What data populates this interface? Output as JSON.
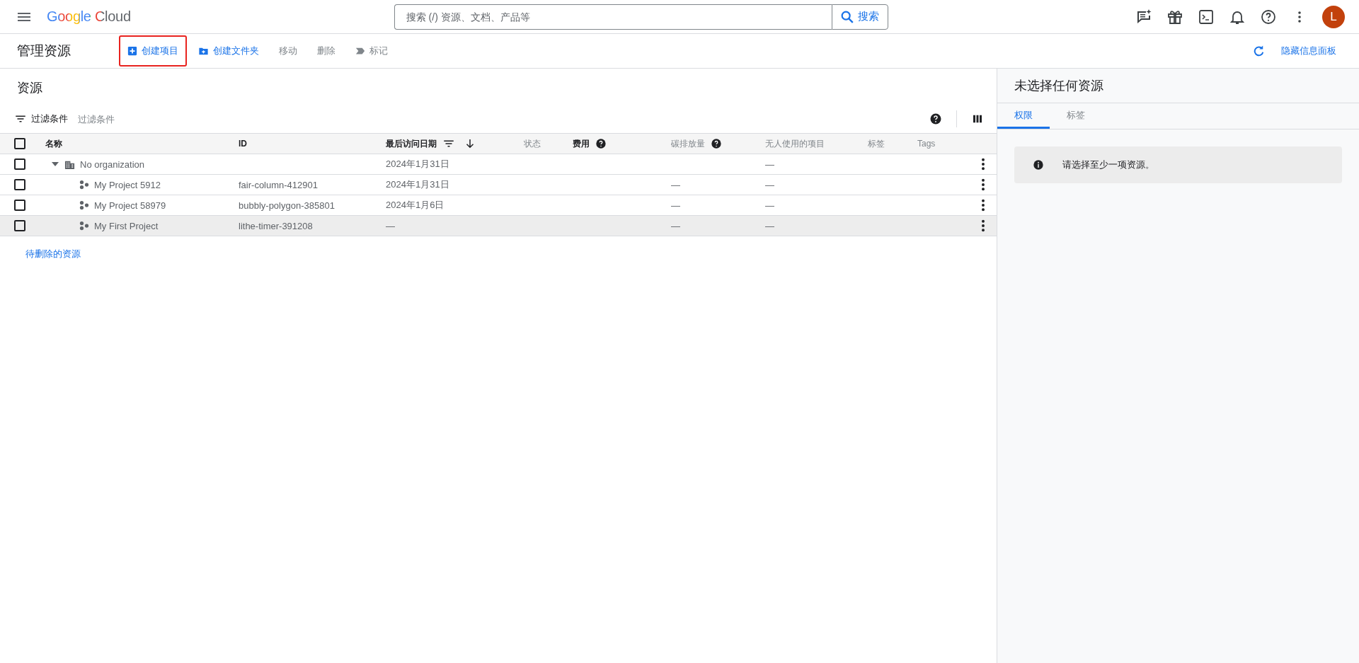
{
  "header": {
    "brand": "Google Cloud",
    "search": {
      "placeholder": "搜索 (/) 资源、文档、产品等",
      "button": "搜索"
    },
    "avatar": "L"
  },
  "toolbar": {
    "title": "管理资源",
    "actions": [
      {
        "label": "创建项目",
        "disabled": false,
        "highlighted": true
      },
      {
        "label": "创建文件夹",
        "disabled": false,
        "highlighted": false
      },
      {
        "label": "移动",
        "disabled": true,
        "highlighted": false
      },
      {
        "label": "删除",
        "disabled": true,
        "highlighted": false
      },
      {
        "label": "标记",
        "disabled": true,
        "highlighted": false
      }
    ],
    "hide_panel": "隐藏信息面板"
  },
  "resources": {
    "title": "资源",
    "select_all_checked": false,
    "filter": {
      "label": "过滤条件",
      "placeholder": "过滤条件"
    },
    "columns": [
      {
        "label": "名称",
        "dark": true,
        "help": false,
        "sort": false
      },
      {
        "label": "ID",
        "dark": true,
        "help": false,
        "sort": false
      },
      {
        "label": "最后访问日期",
        "dark": true,
        "help": false,
        "sort": true
      },
      {
        "label": "状态",
        "dark": false,
        "help": false,
        "sort": false
      },
      {
        "label": "费用",
        "dark": true,
        "help": true,
        "sort": false
      },
      {
        "label": "碳排放量",
        "dark": false,
        "help": true,
        "sort": false
      },
      {
        "label": "无人使用的项目",
        "dark": false,
        "help": false,
        "sort": false
      },
      {
        "label": "标签",
        "dark": false,
        "help": false,
        "sort": false
      },
      {
        "label": "Tags",
        "dark": false,
        "help": false,
        "sort": false
      }
    ],
    "rows": [
      {
        "kind": "organization",
        "name": "No organization",
        "id": "",
        "date": "2024年1月31日",
        "carbon": "",
        "unused": "—",
        "checked": false,
        "expanded": true,
        "children": [
          {
            "kind": "project",
            "name": "My Project 5912",
            "id": "fair-column-412901",
            "date": "2024年1月31日",
            "carbon": "—",
            "unused": "—",
            "checked": false,
            "hovered": false
          },
          {
            "kind": "project",
            "name": "My Project 58979",
            "id": "bubbly-polygon-385801",
            "date": "2024年1月6日",
            "carbon": "—",
            "unused": "—",
            "checked": false,
            "hovered": false
          },
          {
            "kind": "project",
            "name": "My First Project",
            "id": "lithe-timer-391208",
            "date": "—",
            "carbon": "—",
            "unused": "—",
            "checked": false,
            "hovered": true
          }
        ]
      }
    ],
    "pending_link": "待删除的资源"
  },
  "panel": {
    "title": "未选择任何资源",
    "tabs": [
      {
        "label": "权限",
        "selected": true
      },
      {
        "label": "标签",
        "selected": false
      }
    ],
    "message": "请选择至少一项资源。"
  }
}
